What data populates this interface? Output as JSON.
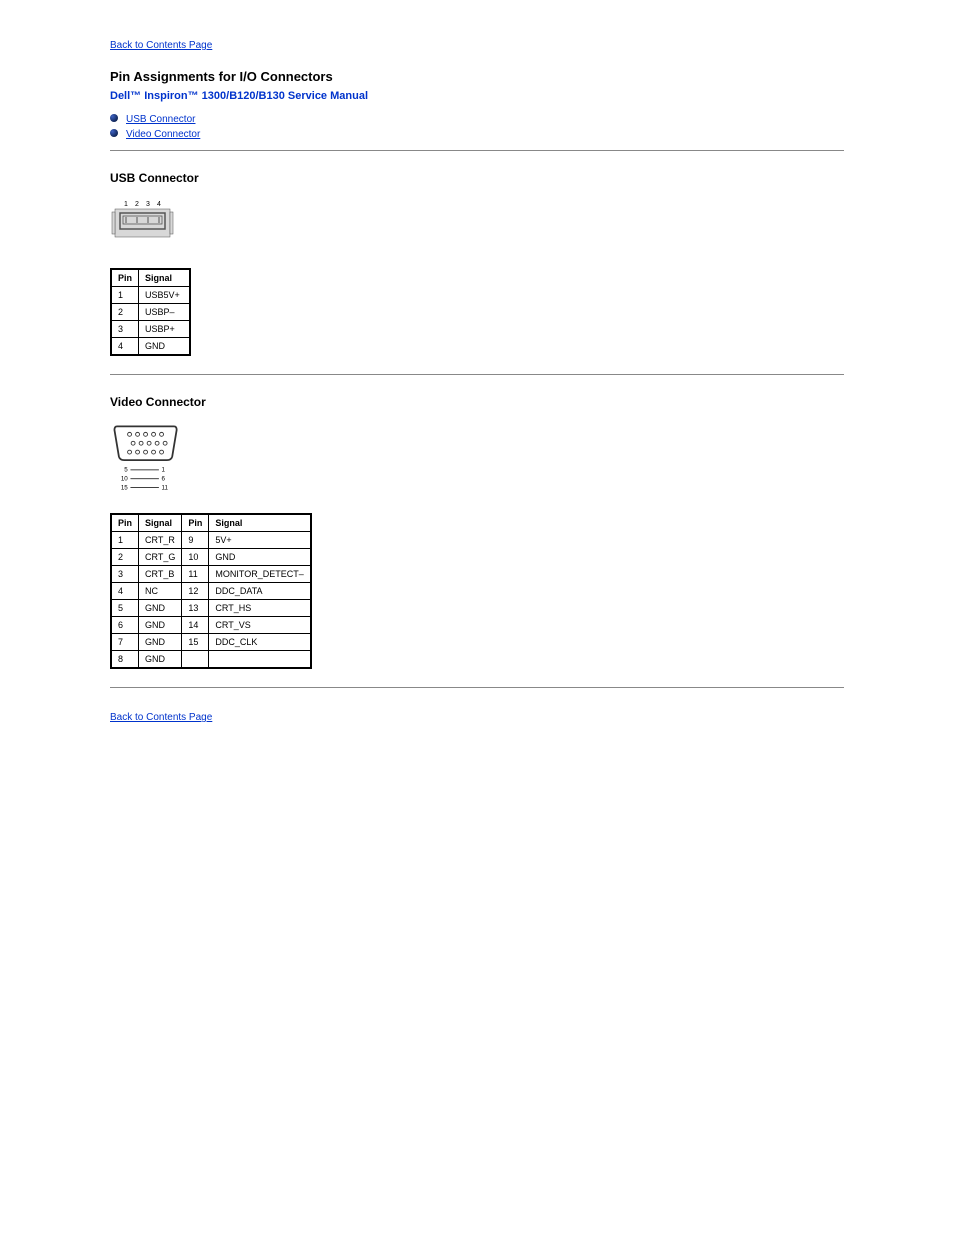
{
  "nav": {
    "back_top": "Back to Contents Page",
    "back_bottom": "Back to Contents Page"
  },
  "header": {
    "title": "Pin Assignments for I/O Connectors",
    "subtitle": "Dell™ Inspiron™ 1300/B120/B130  Service Manual"
  },
  "links": {
    "usb": "USB Connector",
    "video": "Video Connector"
  },
  "usb": {
    "heading": "USB Connector",
    "table_headers": {
      "pin": "Pin",
      "signal": "Signal"
    },
    "rows": [
      {
        "pin": "1",
        "signal": "USB5V+"
      },
      {
        "pin": "2",
        "signal": "USBP–"
      },
      {
        "pin": "3",
        "signal": "USBP+"
      },
      {
        "pin": "4",
        "signal": "GND"
      }
    ],
    "diagram_labels": [
      "1",
      "2",
      "3",
      "4"
    ]
  },
  "video": {
    "heading": "Video Connector",
    "table_headers": {
      "pin": "Pin",
      "signal": "Signal"
    },
    "rows": [
      {
        "pin1": "1",
        "sig1": "CRT_R",
        "pin2": "9",
        "sig2": "5V+"
      },
      {
        "pin1": "2",
        "sig1": "CRT_G",
        "pin2": "10",
        "sig2": "GND"
      },
      {
        "pin1": "3",
        "sig1": "CRT_B",
        "pin2": "11",
        "sig2": "MONITOR_DETECT–"
      },
      {
        "pin1": "4",
        "sig1": "NC",
        "pin2": "12",
        "sig2": "DDC_DATA"
      },
      {
        "pin1": "5",
        "sig1": "GND",
        "pin2": "13",
        "sig2": "CRT_HS"
      },
      {
        "pin1": "6",
        "sig1": "GND",
        "pin2": "14",
        "sig2": "CRT_VS"
      },
      {
        "pin1": "7",
        "sig1": "GND",
        "pin2": "15",
        "sig2": "DDC_CLK"
      },
      {
        "pin1": "8",
        "sig1": "GND",
        "pin2": "",
        "sig2": ""
      }
    ],
    "diagram_labels": {
      "left": [
        "5",
        "10",
        "15"
      ],
      "right": [
        "1",
        "6",
        "11"
      ]
    }
  }
}
